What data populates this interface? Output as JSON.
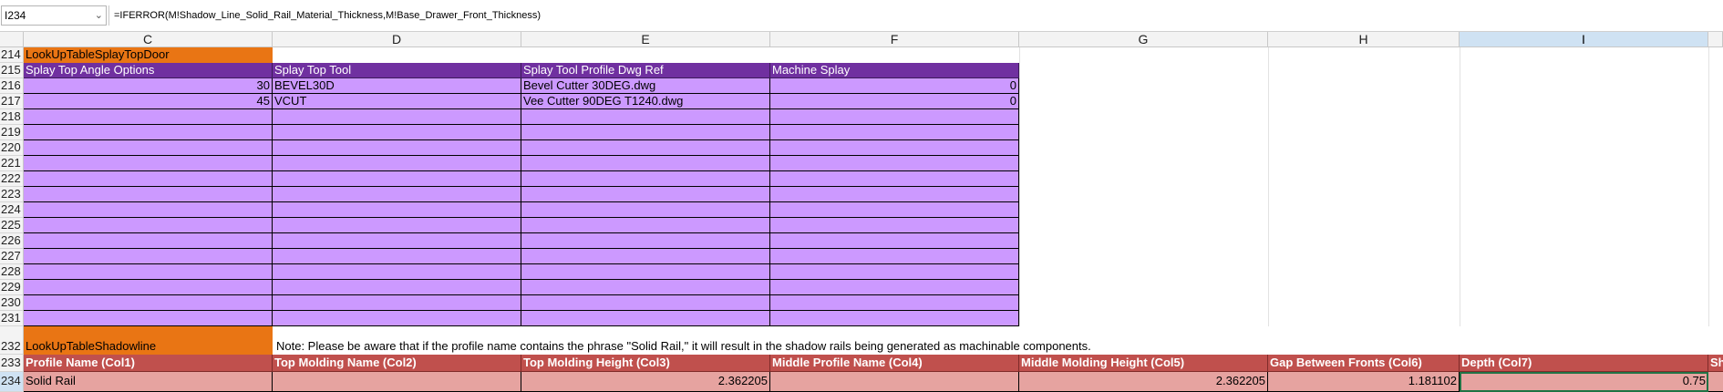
{
  "formula_bar": {
    "name_box": "I234",
    "formula": "=IFERROR(M!Shadow_Line_Solid_Rail_Material_Thickness,M!Base_Drawer_Front_Thickness)"
  },
  "columns": [
    "C",
    "D",
    "E",
    "F",
    "G",
    "H",
    "I"
  ],
  "rows": [
    "214",
    "215",
    "216",
    "217",
    "218",
    "219",
    "220",
    "221",
    "222",
    "223",
    "224",
    "225",
    "226",
    "227",
    "228",
    "229",
    "230",
    "231",
    "232",
    "233",
    "234"
  ],
  "table1": {
    "name": "LookUpTableSplayTopDoor",
    "headers": [
      "Splay Top Angle Options",
      "Splay Top Tool",
      "Splay Tool Profile Dwg Ref",
      "Machine Splay"
    ],
    "rows": [
      [
        "30",
        "BEVEL30D",
        "Bevel Cutter 30DEG.dwg",
        "0"
      ],
      [
        "45",
        "VCUT",
        "Vee Cutter 90DEG T1240.dwg",
        "0"
      ]
    ]
  },
  "table2": {
    "name": "LookUpTableShadowline",
    "note": "Note: Please be aware that if the profile name contains the phrase \"Solid Rail,\" it will result in the shadow rails being generated as machinable components.",
    "headers": [
      "Profile Name (Col1)",
      "Top Molding Name (Col2)",
      "Top Molding Height (Col3)",
      "Middle Profile Name (Col4)",
      "Middle Molding Height (Col5)",
      "Gap Between Fronts (Col6)",
      "Depth (Col7)",
      "Sh"
    ],
    "row": [
      "Solid Rail",
      "",
      "2.362205",
      "",
      "2.362205",
      "1.181102",
      "0.75"
    ]
  },
  "colors": {
    "orange": "#e97514",
    "purple_header": "#7030a0",
    "lilac": "#cc99ff",
    "red_header": "#c0504d",
    "pink": "#e6a3a0"
  }
}
